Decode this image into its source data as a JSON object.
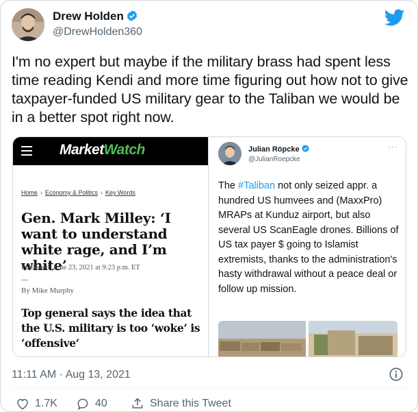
{
  "author": {
    "name": "Drew Holden",
    "handle": "@DrewHolden360"
  },
  "tweet": {
    "text": "I'm no expert but maybe if the military brass had spent less time reading Kendi and more time figuring out how not to give taxpayer-funded US military gear to the Taliban we would be in a better spot right now."
  },
  "marketwatch": {
    "logo_a": "Market",
    "logo_b": "Watch",
    "breadcrumb": [
      "Home",
      "Economy & Politics",
      "Key Words"
    ],
    "headline": "Gen. Mark Milley: ‘I want to understand white rage, and I’m white’",
    "published": "Published: June 23, 2021 at 9:23 p.m. ET",
    "byline": "By Mike Murphy",
    "subhead": "Top general says the idea that the U.S. military is too ‘woke’ is ‘offensive’"
  },
  "embedded": {
    "name": "Julian Röpcke",
    "handle": "@JulianRoepcke",
    "more": "···",
    "hashtag": "#Taliban",
    "text_before": "The ",
    "text_after": " not only seized appr. a hundred US humvees and (MaxxPro) MRAPs at Kunduz airport, but also several US ScanEagle drones. Billions of US tax payer $ going to Islamist extremists, thanks to the administration's hasty withdrawal without a peace deal or follow up mission."
  },
  "meta": {
    "timestamp": "11:11 AM · Aug 13, 2021"
  },
  "actions": {
    "likes": "1.7K",
    "replies": "40",
    "share": "Share this Tweet"
  },
  "colors": {
    "twitter_blue": "#1d9bf0",
    "marketwatch_green": "#4fbf55",
    "secondary_text": "#536471"
  },
  "icons": [
    "verified-badge-icon",
    "twitter-bird-icon",
    "hamburger-menu-icon",
    "info-icon",
    "heart-icon",
    "reply-icon",
    "share-icon"
  ]
}
